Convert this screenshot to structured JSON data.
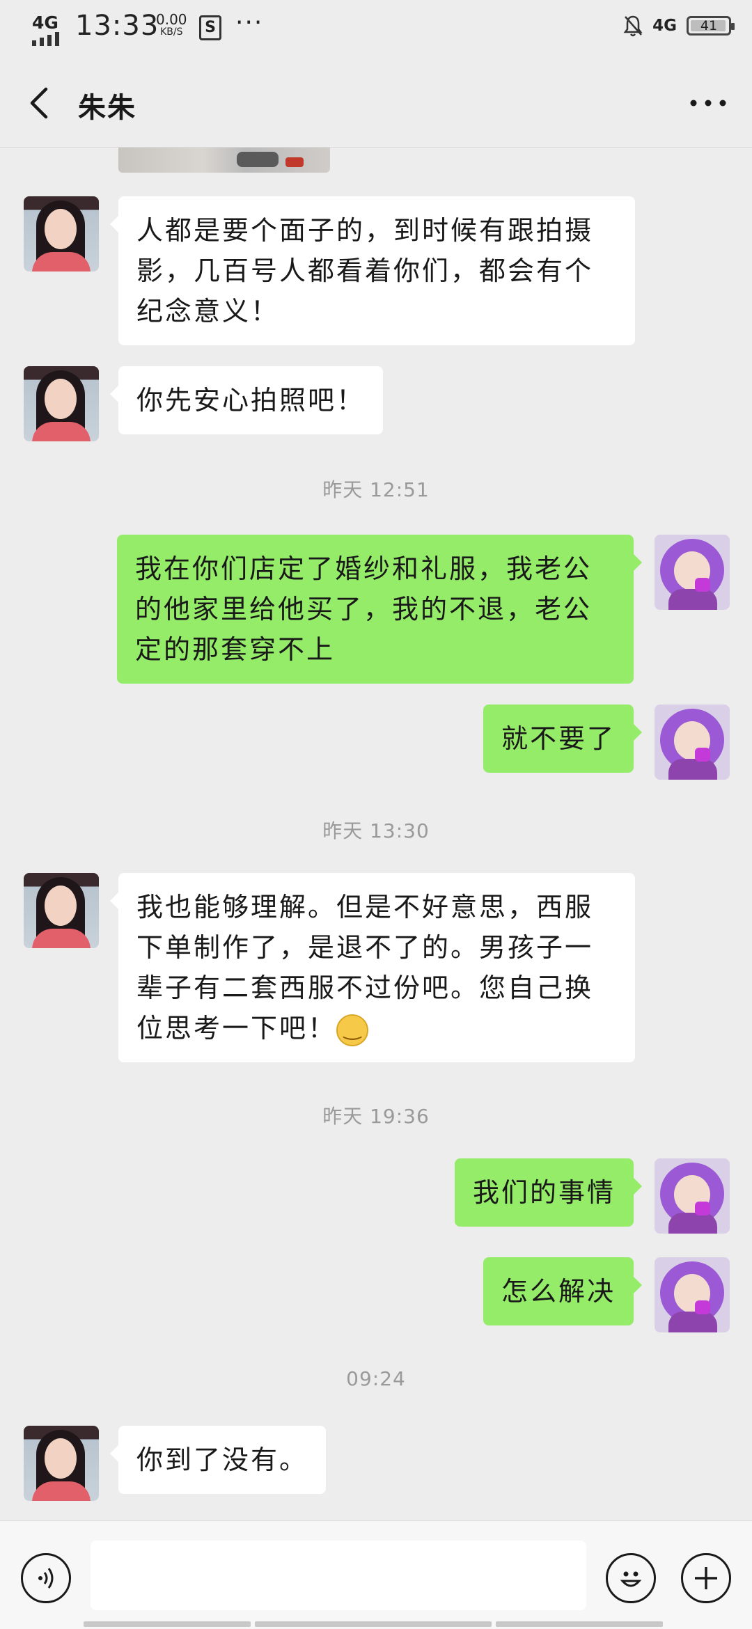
{
  "status_bar": {
    "network": "4G",
    "time": "13:33",
    "speed_value": "0.00",
    "speed_unit": "KB/S",
    "more": "···",
    "network_right": "4G",
    "battery": "41"
  },
  "header": {
    "title": "朱朱",
    "back_icon": "chevron-left-icon",
    "more_icon": "more-horizontal-icon"
  },
  "messages": [
    {
      "side": "in",
      "text": "人都是要个面子的，到时候有跟拍摄影，几百号人都看着你们，都会有个纪念意义！"
    },
    {
      "side": "in",
      "text": "你先安心拍照吧！"
    },
    {
      "type": "time",
      "text": "昨天 12:51"
    },
    {
      "side": "out",
      "text": "我在你们店定了婚纱和礼服，我老公的他家里给他买了，我的不退，老公定的那套穿不上"
    },
    {
      "side": "out",
      "text": "就不要了"
    },
    {
      "type": "time",
      "text": "昨天 13:30"
    },
    {
      "side": "in",
      "text": "我也能够理解。但是不好意思，西服下单制作了，是退不了的。男孩子一辈子有二套西服不过份吧。您自己换位思考一下吧！"
    },
    {
      "type": "time",
      "text": "昨天 19:36"
    },
    {
      "side": "out",
      "text": "我们的事情"
    },
    {
      "side": "out",
      "text": "怎么解决"
    },
    {
      "type": "time",
      "text": "09:24"
    },
    {
      "side": "in",
      "text": "你到了没有。"
    }
  ],
  "input_bar": {
    "voice_icon": "voice-icon",
    "emoji_icon": "smiley-icon",
    "plus_icon": "plus-icon"
  },
  "colors": {
    "outgoing_bubble": "#95EC69",
    "incoming_bubble": "#FFFFFF",
    "background": "#EDEDED"
  }
}
